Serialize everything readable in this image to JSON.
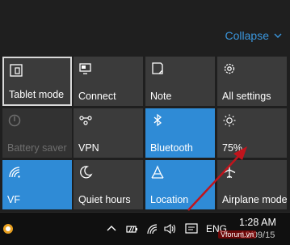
{
  "panel": {
    "collapse_label": "Collapse",
    "accent": "#3a96dd"
  },
  "tiles": {
    "tablet_mode": "Tablet mode",
    "connect": "Connect",
    "note": "Note",
    "all_settings": "All settings",
    "battery_saver": "Battery saver",
    "vpn": "VPN",
    "bluetooth": "Bluetooth",
    "brightness": "75%",
    "wifi": "VF",
    "quiet_hours": "Quiet hours",
    "location": "Location",
    "airplane_mode": "Airplane mode"
  },
  "taskbar": {
    "language": "ENG",
    "time": "1:28 AM",
    "date": "12/09/15"
  },
  "watermark": "Vforum.vn",
  "colors": {
    "tile_active": "#2f8bd6",
    "tile_default": "#3b3b3b",
    "arrow": "#c0141c"
  }
}
